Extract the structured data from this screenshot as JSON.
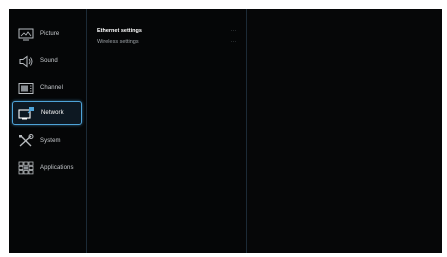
{
  "sidebar": {
    "items": [
      {
        "label": "Picture",
        "icon": "picture-icon"
      },
      {
        "label": "Sound",
        "icon": "speaker-icon"
      },
      {
        "label": "Channel",
        "icon": "channel-icon"
      },
      {
        "label": "Network",
        "icon": "network-icon",
        "selected": true
      },
      {
        "label": "System",
        "icon": "tools-icon"
      },
      {
        "label": "Applications",
        "icon": "applications-icon"
      }
    ]
  },
  "submenu": {
    "items": [
      {
        "label": "Ethernet settings",
        "arrow": "···",
        "active": true
      },
      {
        "label": "Wireless settings",
        "arrow": "···"
      }
    ]
  },
  "colors": {
    "background": "#050607",
    "selection_border": "#4ea3d8",
    "text": "#c9ccd0"
  }
}
